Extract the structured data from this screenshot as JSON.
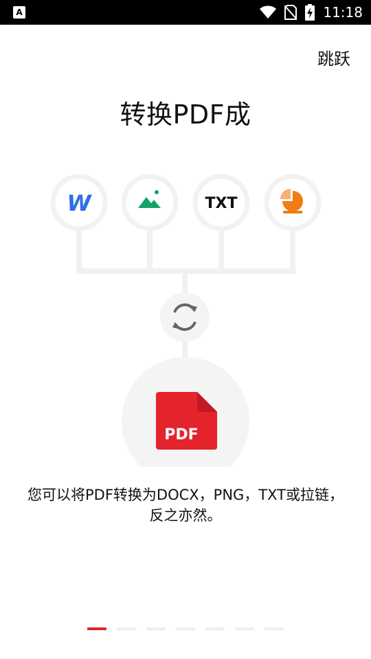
{
  "status_bar": {
    "time": "11:18",
    "icons": [
      "app-notification-icon",
      "wifi-icon",
      "no-sim-icon",
      "battery-charging-icon"
    ]
  },
  "header": {
    "skip_label": "跳跃"
  },
  "main": {
    "title": "转换PDF成",
    "formats": [
      {
        "icon": "word-icon",
        "label": "W"
      },
      {
        "icon": "image-icon",
        "label": ""
      },
      {
        "icon": "txt-icon",
        "label": "TXT"
      },
      {
        "icon": "presentation-icon",
        "label": ""
      }
    ],
    "convert_icon": "convert-icon",
    "pdf_label": "PDF",
    "description": "您可以将PDF转换为DOCX，PNG，TXT或拉链，反之亦然。"
  },
  "pager": {
    "count": 7,
    "active_index": 0
  },
  "colors": {
    "accent": "#e02228",
    "word_blue": "#2f6fe8",
    "image_green": "#12a36b",
    "ppt_orange": "#f07c14",
    "pdf_red": "#e5232c",
    "circle_gray": "#f4f4f4"
  }
}
